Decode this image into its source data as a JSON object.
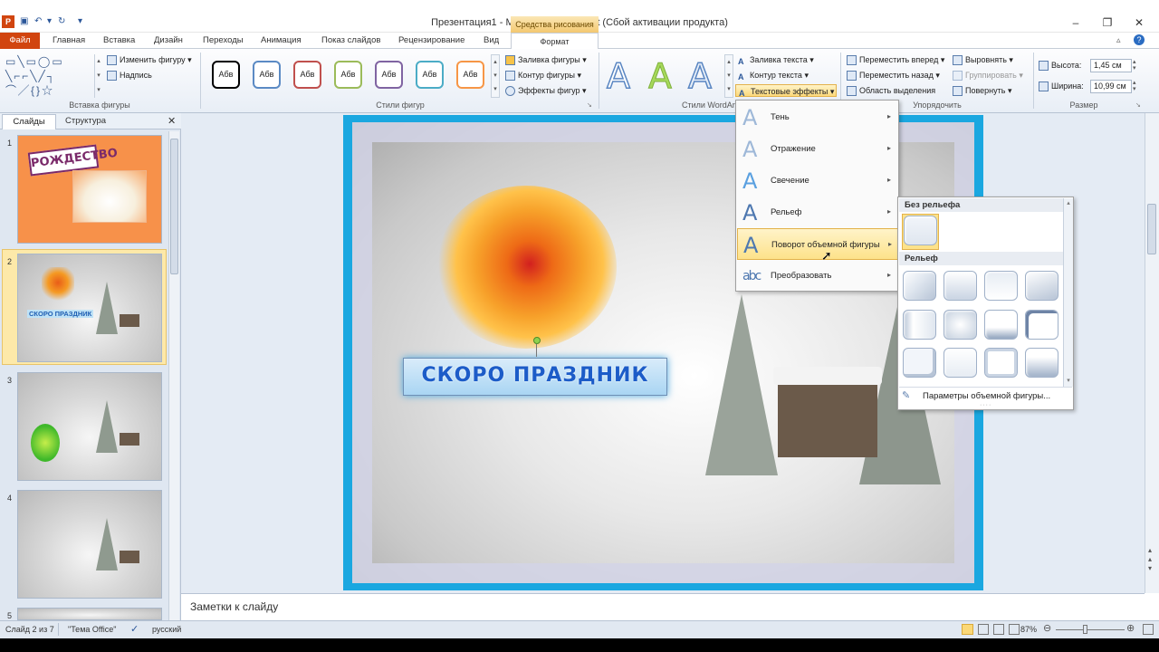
{
  "window": {
    "title": "Презентация1 - Microsoft PowerPoint (Сбой активации продукта)",
    "contextual_tab_group": "Средства рисования"
  },
  "tabs": [
    "Файл",
    "Главная",
    "Вставка",
    "Дизайн",
    "Переходы",
    "Анимация",
    "Показ слайдов",
    "Рецензирование",
    "Вид",
    "Формат"
  ],
  "ribbon": {
    "insert_shape": {
      "edit_shape": "Изменить фигуру",
      "text_box": "Надпись",
      "label": "Вставка фигуры"
    },
    "shape_styles": {
      "style_text": "Абв",
      "style_colors": [
        "#000000",
        "#5b8ac4",
        "#c0504d",
        "#9bbb59",
        "#8064a2",
        "#4bacc6",
        "#f79646"
      ],
      "fill": "Заливка фигуры",
      "outline": "Контур фигуры",
      "effects": "Эффекты фигур",
      "label": "Стили фигур"
    },
    "wordart": {
      "text_fill": "Заливка текста",
      "text_outline": "Контур текста",
      "text_effects": "Текстовые эффекты",
      "label": "Стили WordArt",
      "sample_letter": "A"
    },
    "arrange": {
      "bring_forward": "Переместить вперед",
      "send_backward": "Переместить назад",
      "selection_pane": "Область выделения",
      "align": "Выровнять",
      "group": "Группировать",
      "rotate": "Повернуть",
      "label": "Упорядочить"
    },
    "size": {
      "height_label": "Высота:",
      "height_value": "1,45 см",
      "width_label": "Ширина:",
      "width_value": "10,99 см",
      "label": "Размер"
    }
  },
  "left_pane": {
    "tab_slides": "Слайды",
    "tab_outline": "Структура",
    "slides": [
      {
        "num": "1",
        "text": "РОЖДЕСТВО"
      },
      {
        "num": "2",
        "text": "СКОРО ПРАЗДНИК"
      },
      {
        "num": "3",
        "text": ""
      },
      {
        "num": "4",
        "text": ""
      },
      {
        "num": "5",
        "text": ""
      }
    ]
  },
  "slide": {
    "headline": "СКОРО ПРАЗДНИК"
  },
  "text_effects_menu": {
    "items": [
      "Тень",
      "Отражение",
      "Свечение",
      "Рельеф",
      "Поворот объемной фигуры",
      "Преобразовать"
    ],
    "highlighted": "Поворот объемной фигуры"
  },
  "bevel_gallery": {
    "no_bevel_header": "Без рельефа",
    "bevel_header": "Рельеф",
    "options_link": "Параметры объемной фигуры..."
  },
  "notes": {
    "placeholder": "Заметки к слайду"
  },
  "status": {
    "slide_counter": "Слайд 2 из 7",
    "theme": "\"Тема Office\"",
    "language": "русский",
    "zoom": "87%"
  },
  "colors": {
    "file_tab": "#d1450f",
    "slide_border": "#1aa7e0",
    "highlight": "#fde28a"
  }
}
